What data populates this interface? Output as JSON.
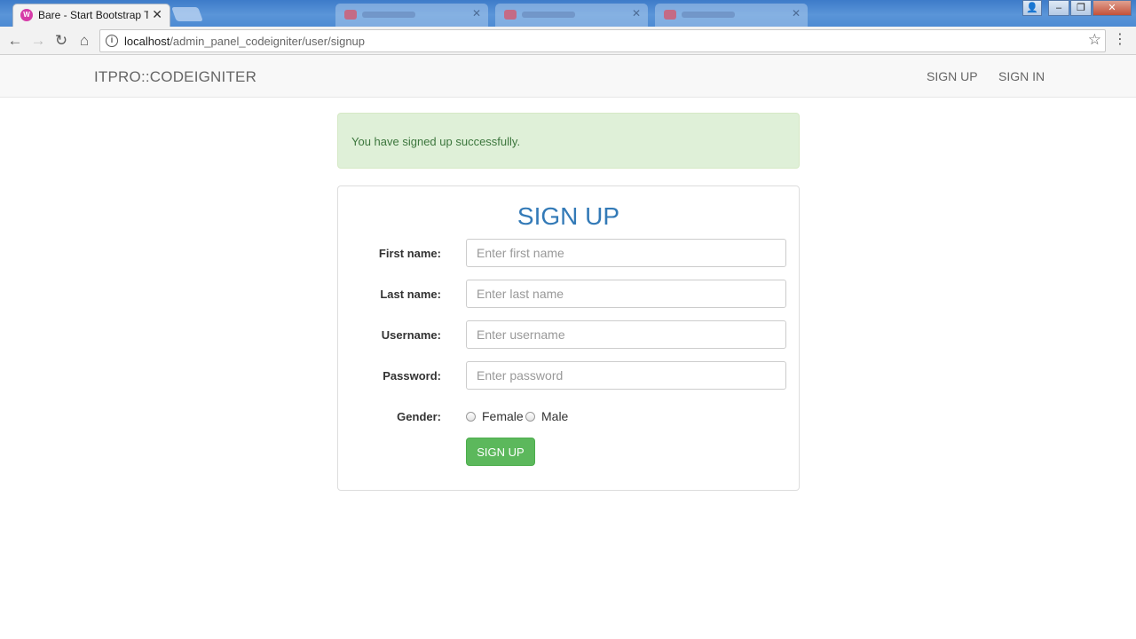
{
  "browser": {
    "active_tab_title": "Bare - Start Bootstrap Te",
    "active_tab_favicon": "W",
    "url_host": "localhost",
    "url_path": "/admin_panel_codeigniter/user/signup"
  },
  "navbar": {
    "brand": "ITPRO::CODEIGNITER",
    "links": [
      "SIGN UP",
      "SIGN IN"
    ]
  },
  "alert": {
    "message": "You have signed up successfully."
  },
  "form": {
    "title": "SIGN UP",
    "fields": [
      {
        "label": "First name:",
        "placeholder": "Enter first name"
      },
      {
        "label": "Last name:",
        "placeholder": "Enter last name"
      },
      {
        "label": "Username:",
        "placeholder": "Enter username"
      },
      {
        "label": "Password:",
        "placeholder": "Enter password"
      }
    ],
    "gender_label": "Gender:",
    "gender_options": [
      "Female",
      "Male"
    ],
    "submit_label": "SIGN UP"
  },
  "colors": {
    "brand_blue": "#337ab7",
    "success_green": "#5cb85c",
    "alert_bg": "#dff0d8",
    "alert_text": "#3c763d"
  }
}
